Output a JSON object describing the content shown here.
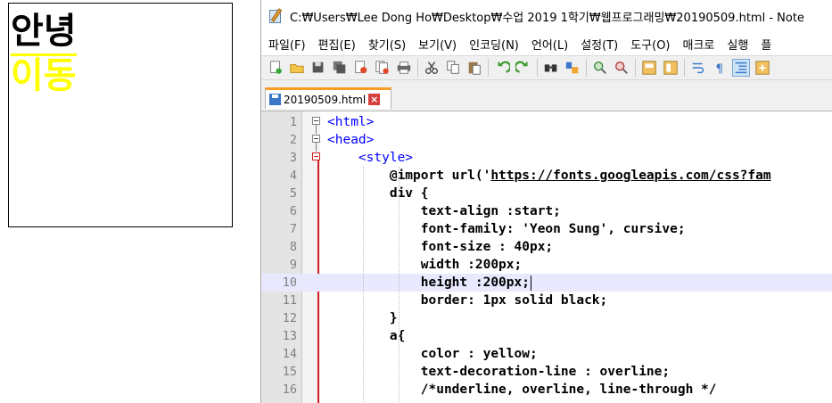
{
  "preview": {
    "hello_text": "안녕",
    "link_text": "이동"
  },
  "editor": {
    "title": "C:₩Users₩Lee Dong Ho₩Desktop₩수업 2019 1학기₩웹프로그래밍₩20190509.html - Note",
    "menu": [
      "파일(F)",
      "편집(E)",
      "찾기(S)",
      "보기(V)",
      "인코딩(N)",
      "언어(L)",
      "설정(T)",
      "도구(O)",
      "매크로",
      "실행",
      "플"
    ],
    "toolbar": [
      "new-file-icon",
      "open-file-icon",
      "save-icon",
      "save-all-icon",
      "close-icon",
      "close-all-icon",
      "print-icon",
      "cut-icon",
      "copy-icon",
      "paste-icon",
      "undo-icon",
      "redo-icon",
      "find-icon",
      "replace-icon",
      "zoom-in-icon",
      "zoom-out-icon",
      "sync-vertical-icon",
      "sync-horizontal-icon",
      "word-wrap-icon",
      "show-all-chars-icon",
      "indent-guide-icon",
      "udl-icon"
    ],
    "tab_label": "20190509.html",
    "current_line": 10,
    "lines": [
      {
        "n": "1",
        "text": "<html>"
      },
      {
        "n": "2",
        "text": "<head>"
      },
      {
        "n": "3",
        "text": "    <style>"
      },
      {
        "n": "4",
        "text": "        @import url('https://fonts.googleapis.com/css?fam"
      },
      {
        "n": "5",
        "text": "        div {"
      },
      {
        "n": "6",
        "text": "            text-align :start;"
      },
      {
        "n": "7",
        "text": "            font-family: 'Yeon Sung', cursive;"
      },
      {
        "n": "8",
        "text": "            font-size : 40px;"
      },
      {
        "n": "9",
        "text": "            width :200px;"
      },
      {
        "n": "10",
        "text": "            height :200px;"
      },
      {
        "n": "11",
        "text": "            border: 1px solid black;"
      },
      {
        "n": "12",
        "text": "        }"
      },
      {
        "n": "13",
        "text": "        a{"
      },
      {
        "n": "14",
        "text": "            color : yellow;"
      },
      {
        "n": "15",
        "text": "            text-decoration-line : overline;"
      },
      {
        "n": "16",
        "text": "            /*underline, overline, line-through */"
      }
    ]
  },
  "colors": {
    "link_yellow": "#ffff00",
    "tag_blue": "#0000ff",
    "tab_accent": "#fa9d22",
    "current_line_bg": "#e8e8ff",
    "fold_red": "#d22020"
  }
}
